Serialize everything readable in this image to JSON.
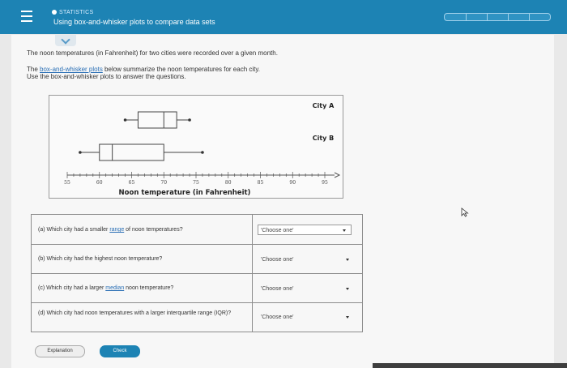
{
  "header": {
    "module": "STATISTICS",
    "title": "Using box-and-whisker plots to compare data sets"
  },
  "problem": {
    "line1": "The noon temperatures (in Fahrenheit) for two cities were recorded over a given month.",
    "line2_pre": "The ",
    "line2_link": "box-and-whisker plots",
    "line2_post": " below summarize the noon temperatures for each city.",
    "line3": "Use the box-and-whisker plots to answer the questions."
  },
  "chart_data": {
    "type": "box",
    "xlabel": "Noon temperature (in Fahrenheit)",
    "xlim": [
      55,
      95
    ],
    "ticks": [
      55,
      60,
      65,
      70,
      75,
      80,
      85,
      90,
      95
    ],
    "series": [
      {
        "name": "City A",
        "min": 64,
        "q1": 66,
        "median": 70,
        "q3": 72,
        "max": 74
      },
      {
        "name": "City B",
        "min": 57,
        "q1": 60,
        "median": 62,
        "q3": 70,
        "max": 76
      }
    ]
  },
  "questions": [
    {
      "id": "a",
      "pre": "(a) Which city had a smaller ",
      "link": "range",
      "post": " of noon temperatures?",
      "value": "'Choose one'"
    },
    {
      "id": "b",
      "pre": "(b) Which city had the highest noon temperature?",
      "link": "",
      "post": "",
      "value": "'Choose one'"
    },
    {
      "id": "c",
      "pre": "(c) Which city had a larger ",
      "link": "median",
      "post": " noon temperature?",
      "value": "'Choose one'"
    },
    {
      "id": "d",
      "pre": "(d) Which city had noon temperatures with a larger interquartile range (IQR)?",
      "link": "",
      "post": "",
      "value": "'Choose one'"
    }
  ],
  "buttons": {
    "explanation": "Explanation",
    "check": "Check"
  },
  "colors": {
    "header": "#1d83b4",
    "link": "#2a6fb5"
  }
}
